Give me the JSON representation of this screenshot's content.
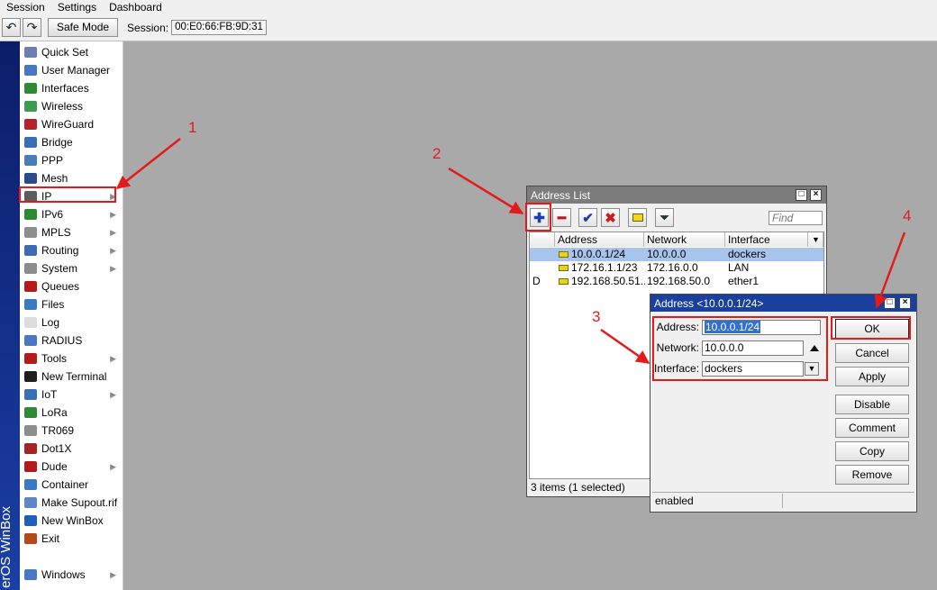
{
  "menubar": {
    "items": [
      "Session",
      "Settings",
      "Dashboard"
    ]
  },
  "toolbar": {
    "safe_mode": "Safe Mode",
    "session_label": "Session:",
    "session_value": "00:E0:66:FB:9D:31"
  },
  "brand": "erOS WinBox",
  "sidebar": {
    "items": [
      {
        "label": "Quick Set",
        "icon": "wand-icon",
        "color": "#6a7fb0",
        "sub": false
      },
      {
        "label": "User Manager",
        "icon": "users-icon",
        "color": "#4a77c4",
        "sub": false
      },
      {
        "label": "Interfaces",
        "icon": "interfaces-icon",
        "color": "#2f8a36",
        "sub": false
      },
      {
        "label": "Wireless",
        "icon": "wireless-icon",
        "color": "#3e9b53",
        "sub": false
      },
      {
        "label": "WireGuard",
        "icon": "wireguard-icon",
        "color": "#b4232b",
        "sub": false
      },
      {
        "label": "Bridge",
        "icon": "bridge-icon",
        "color": "#3a6fb3",
        "sub": false
      },
      {
        "label": "PPP",
        "icon": "ppp-icon",
        "color": "#487db8",
        "sub": false
      },
      {
        "label": "Mesh",
        "icon": "mesh-icon",
        "color": "#2a4c8c",
        "sub": false
      },
      {
        "label": "IP",
        "icon": "ip-icon",
        "color": "#5d5d5d",
        "sub": true
      },
      {
        "label": "IPv6",
        "icon": "ipv6-icon",
        "color": "#2f8a36",
        "sub": true
      },
      {
        "label": "MPLS",
        "icon": "mpls-icon",
        "color": "#8d8d8d",
        "sub": true
      },
      {
        "label": "Routing",
        "icon": "routing-icon",
        "color": "#3e6cb2",
        "sub": true
      },
      {
        "label": "System",
        "icon": "system-icon",
        "color": "#8c8c8c",
        "sub": true
      },
      {
        "label": "Queues",
        "icon": "queues-icon",
        "color": "#b31b1b",
        "sub": false
      },
      {
        "label": "Files",
        "icon": "files-icon",
        "color": "#3b78c4",
        "sub": false
      },
      {
        "label": "Log",
        "icon": "log-icon",
        "color": "#dcdcdc",
        "sub": false
      },
      {
        "label": "RADIUS",
        "icon": "radius-icon",
        "color": "#4a77c4",
        "sub": false
      },
      {
        "label": "Tools",
        "icon": "tools-icon",
        "color": "#b31b1b",
        "sub": true
      },
      {
        "label": "New Terminal",
        "icon": "terminal-icon",
        "color": "#1f1f1f",
        "sub": false
      },
      {
        "label": "IoT",
        "icon": "iot-icon",
        "color": "#3a6fb3",
        "sub": true
      },
      {
        "label": "LoRa",
        "icon": "lora-icon",
        "color": "#2f8a36",
        "sub": false
      },
      {
        "label": "TR069",
        "icon": "tr069-icon",
        "color": "#8d8d8d",
        "sub": false
      },
      {
        "label": "Dot1X",
        "icon": "dot1x-icon",
        "color": "#a52323",
        "sub": false
      },
      {
        "label": "Dude",
        "icon": "dude-icon",
        "color": "#b31b1b",
        "sub": true
      },
      {
        "label": "Container",
        "icon": "container-icon",
        "color": "#3b78c4",
        "sub": false
      },
      {
        "label": "Make Supout.rif",
        "icon": "supout-icon",
        "color": "#5f87c7",
        "sub": false
      },
      {
        "label": "New WinBox",
        "icon": "winbox-icon",
        "color": "#1f5fb8",
        "sub": false
      },
      {
        "label": "Exit",
        "icon": "exit-icon",
        "color": "#b34b1b",
        "sub": false
      }
    ],
    "windows_label": "Windows"
  },
  "address_list": {
    "title": "Address List",
    "find_placeholder": "Find",
    "columns": {
      "address": "Address",
      "network": "Network",
      "interface": "Interface"
    },
    "rows": [
      {
        "flag": "",
        "address": "10.0.0.1/24",
        "network": "10.0.0.0",
        "interface": "dockers",
        "selected": true
      },
      {
        "flag": "",
        "address": "172.16.1.1/23",
        "network": "172.16.0.0",
        "interface": "LAN",
        "selected": false
      },
      {
        "flag": "D",
        "address": "192.168.50.51...",
        "network": "192.168.50.0",
        "interface": "ether1",
        "selected": false
      }
    ],
    "status": "3 items (1 selected)"
  },
  "address_dialog": {
    "title": "Address <10.0.0.1/24>",
    "address_label": "Address:",
    "address_value": "10.0.0.1/24",
    "network_label": "Network:",
    "network_value": "10.0.0.0",
    "interface_label": "Interface:",
    "interface_value": "dockers",
    "buttons": {
      "ok": "OK",
      "cancel": "Cancel",
      "apply": "Apply",
      "disable": "Disable",
      "comment": "Comment",
      "copy": "Copy",
      "remove": "Remove"
    },
    "status": "enabled"
  },
  "annotations": {
    "step1": "1",
    "step2": "2",
    "step3": "3",
    "step4": "4"
  },
  "colors": {
    "accent_red": "#e31b1b",
    "title_bar": "#7c7c7c",
    "selection": "#a6c4ec",
    "brand": "#1a3fa6"
  }
}
